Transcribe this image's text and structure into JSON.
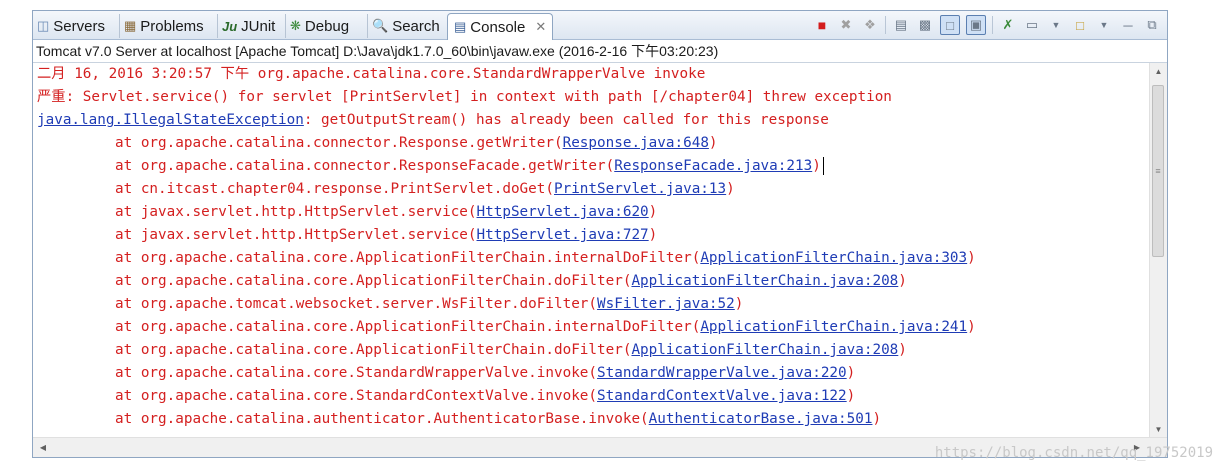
{
  "tabs": [
    {
      "label": "Servers",
      "icon": "servers-icon"
    },
    {
      "label": "Problems",
      "icon": "problems-icon"
    },
    {
      "label": "JUnit",
      "icon": "junit-icon"
    },
    {
      "label": "Debug",
      "icon": "debug-icon"
    },
    {
      "label": "Search",
      "icon": "search-icon"
    },
    {
      "label": "Console",
      "icon": "console-icon",
      "active": true
    }
  ],
  "toolbar_icons": [
    "terminate-icon",
    "remove-launch-icon",
    "remove-all-icon",
    "scroll-lock-icon",
    "word-wrap-icon",
    "show-stdout-icon",
    "show-stderr-icon",
    "pin-console-icon",
    "display-console-icon",
    "dropdown-icon",
    "open-console-icon",
    "dropdown-icon",
    "minimize-icon",
    "maximize-icon"
  ],
  "console_title": "Tomcat v7.0 Server at localhost [Apache Tomcat] D:\\Java\\jdk1.7.0_60\\bin\\javaw.exe (2016-2-16 下午03:20:23)",
  "log": {
    "l1": "二月 16, 2016 3:20:57 下午 org.apache.catalina.core.StandardWrapperValve invoke",
    "l2": "严重: Servlet.service() for servlet [PrintServlet] in context with path [/chapter04] threw exception",
    "l3_link": "java.lang.IllegalStateException",
    "l3_text": ": getOutputStream() has already been called for this response"
  },
  "stack": [
    {
      "prefix": "at org.apache.catalina.connector.Response.getWriter(",
      "link": "Response.java:648",
      "suffix": ")"
    },
    {
      "prefix": "at org.apache.catalina.connector.ResponseFacade.getWriter(",
      "link": "ResponseFacade.java:213",
      "suffix": ")"
    },
    {
      "prefix": "at cn.itcast.chapter04.response.PrintServlet.doGet(",
      "link": "PrintServlet.java:13",
      "suffix": ")"
    },
    {
      "prefix": "at javax.servlet.http.HttpServlet.service(",
      "link": "HttpServlet.java:620",
      "suffix": ")"
    },
    {
      "prefix": "at javax.servlet.http.HttpServlet.service(",
      "link": "HttpServlet.java:727",
      "suffix": ")"
    },
    {
      "prefix": "at org.apache.catalina.core.ApplicationFilterChain.internalDoFilter(",
      "link": "ApplicationFilterChain.java:303",
      "suffix": ")"
    },
    {
      "prefix": "at org.apache.catalina.core.ApplicationFilterChain.doFilter(",
      "link": "ApplicationFilterChain.java:208",
      "suffix": ")"
    },
    {
      "prefix": "at org.apache.tomcat.websocket.server.WsFilter.doFilter(",
      "link": "WsFilter.java:52",
      "suffix": ")"
    },
    {
      "prefix": "at org.apache.catalina.core.ApplicationFilterChain.internalDoFilter(",
      "link": "ApplicationFilterChain.java:241",
      "suffix": ")"
    },
    {
      "prefix": "at org.apache.catalina.core.ApplicationFilterChain.doFilter(",
      "link": "ApplicationFilterChain.java:208",
      "suffix": ")"
    },
    {
      "prefix": "at org.apache.catalina.core.StandardWrapperValve.invoke(",
      "link": "StandardWrapperValve.java:220",
      "suffix": ")"
    },
    {
      "prefix": "at org.apache.catalina.core.StandardContextValve.invoke(",
      "link": "StandardContextValve.java:122",
      "suffix": ")"
    },
    {
      "prefix": "at org.apache.catalina.authenticator.AuthenticatorBase.invoke(",
      "link": "AuthenticatorBase.java:501",
      "suffix": ")"
    }
  ],
  "watermark": "https://blog.csdn.net/qq_19752019",
  "colors": {
    "error_text": "#d42020",
    "link": "#1f3cb5",
    "tab_border": "#8fa6c2"
  }
}
